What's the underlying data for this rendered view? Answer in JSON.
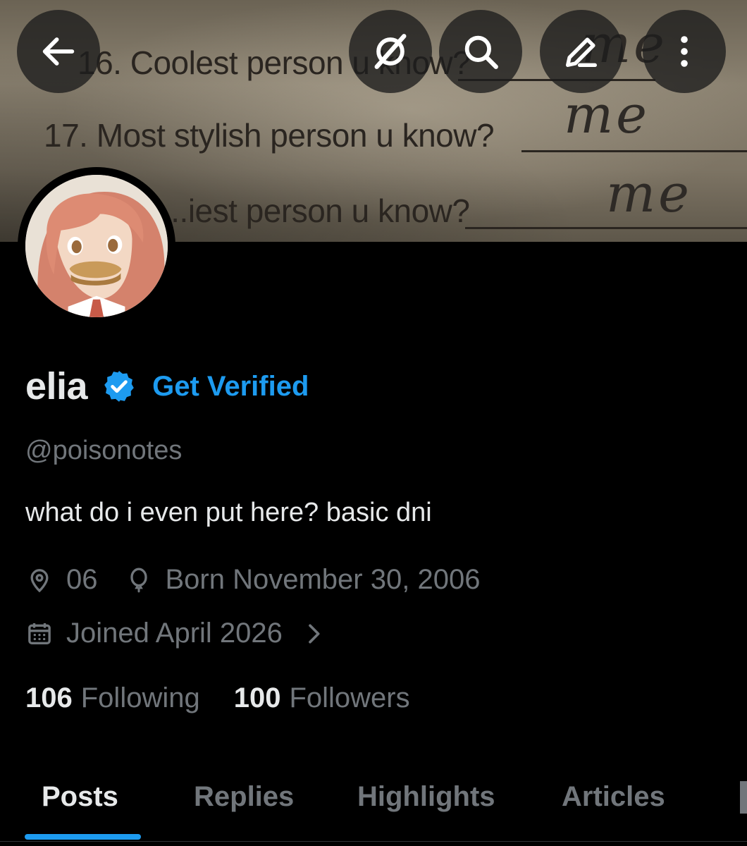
{
  "banner": {
    "lines": [
      "16. Coolest person u know?",
      "17. Most stylish person u know?",
      "...iest person u know?"
    ],
    "answers": [
      "me",
      "me",
      "me"
    ]
  },
  "top_actions": [
    "back-arrow-icon",
    "grok-icon",
    "search-icon",
    "edit-icon",
    "more-vertical-icon"
  ],
  "profile": {
    "display_name": "elia",
    "get_verified_label": "Get Verified",
    "handle": "@poisonotes",
    "bio": "what do i even put here? basic dni",
    "location": "06",
    "birthday": "Born November 30, 2006",
    "joined": "Joined April 2026",
    "following_count": "106",
    "following_label": "Following",
    "followers_count": "100",
    "followers_label": "Followers"
  },
  "tabs": [
    {
      "label": "Posts",
      "active": true
    },
    {
      "label": "Replies",
      "active": false
    },
    {
      "label": "Highlights",
      "active": false
    },
    {
      "label": "Articles",
      "active": false
    }
  ],
  "colors": {
    "accent": "#1d9bf0",
    "background": "#000000",
    "primary_text": "#e7e9ea",
    "secondary_text": "#71767b"
  }
}
